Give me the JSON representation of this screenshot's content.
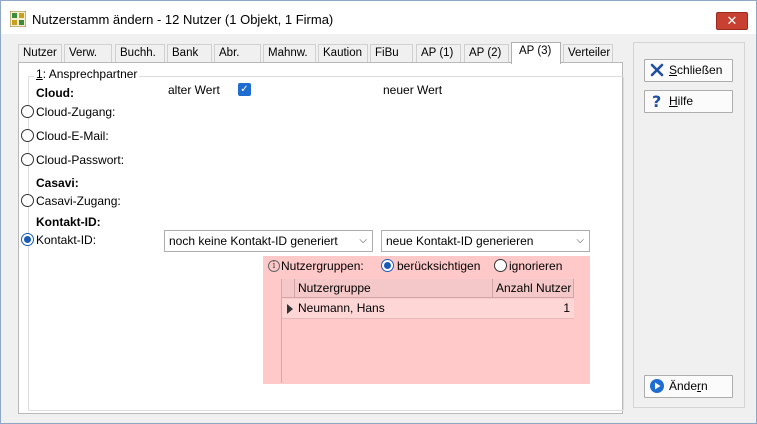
{
  "window": {
    "title": "Nutzerstamm ändern - 12 Nutzer (1 Objekt, 1 Firma)",
    "close_label": "✕"
  },
  "tabs": [
    {
      "label": "Nutzer"
    },
    {
      "label": "Verw."
    },
    {
      "label": "Buchh."
    },
    {
      "label": "Bank"
    },
    {
      "label": "Abr."
    },
    {
      "label": "Mahnw."
    },
    {
      "label": "Kaution"
    },
    {
      "label": "FiBu"
    },
    {
      "label": "AP (1)"
    },
    {
      "label": "AP (2)"
    },
    {
      "label": "AP (3)",
      "active": true
    },
    {
      "label": "Verteiler"
    }
  ],
  "group": {
    "prefix": "1",
    "title": ": Ansprechpartner"
  },
  "columns": {
    "old_value": "alter Wert",
    "new_value": "neuer Wert",
    "old_checked": true
  },
  "sections": {
    "cloud": "Cloud:",
    "casavi": "Casavi:",
    "contact_id": "Kontakt-ID:"
  },
  "fields": {
    "cloud_access": "Cloud-Zugang:",
    "cloud_email": "Cloud-E-Mail:",
    "cloud_password": "Cloud-Passwort:",
    "casavi_access": "Casavi-Zugang:",
    "contact_id": "Kontakt-ID:"
  },
  "contact_id": {
    "old_value": "noch keine Kontakt-ID generiert",
    "new_value": "neue Kontakt-ID generieren"
  },
  "user_groups": {
    "label": "Nutzergruppen:",
    "option_consider": "berücksichtigen",
    "option_ignore": "ignorieren",
    "selected": "berücksichtigen",
    "table": {
      "headers": [
        "Nutzergruppe",
        "Anzahl Nutzer"
      ],
      "rows": [
        {
          "group": "Neumann, Hans",
          "count": "1"
        }
      ]
    }
  },
  "buttons": {
    "close_prefix": "S",
    "close_rest": "chließen",
    "help_prefix": "H",
    "help_rest": "ilfe",
    "apply_head": "Ände",
    "apply_ul": "r",
    "apply_tail": "n"
  },
  "icons": {
    "close_color": "#1f4fa3",
    "help_color": "#1f4fa3",
    "apply_color": "#1f6dd0"
  }
}
